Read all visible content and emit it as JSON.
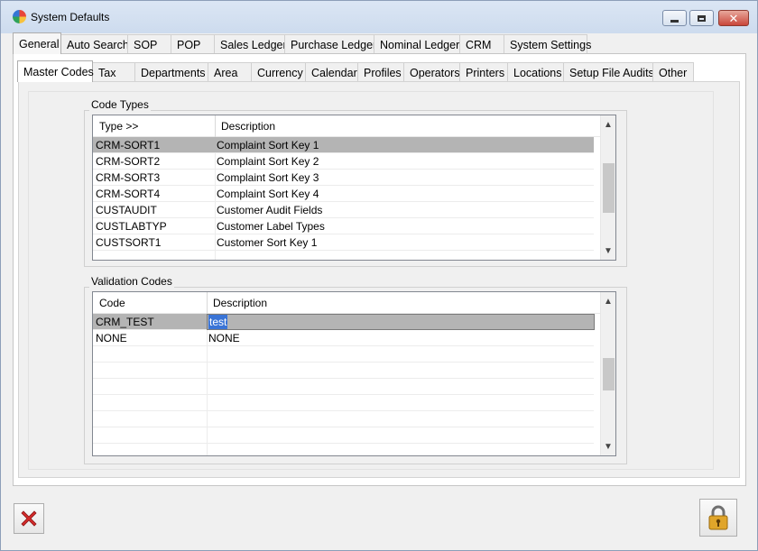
{
  "window": {
    "title": "System Defaults",
    "icon": "app-logo-icon",
    "controls": {
      "minimize": "minimize-icon",
      "maximize": "maximize-icon",
      "close": "close-icon"
    }
  },
  "main_tabs": [
    {
      "label": "General",
      "active": true
    },
    {
      "label": "Auto Search"
    },
    {
      "label": "SOP"
    },
    {
      "label": "POP"
    },
    {
      "label": "Sales Ledger"
    },
    {
      "label": "Purchase Ledger"
    },
    {
      "label": "Nominal Ledger"
    },
    {
      "label": "CRM"
    },
    {
      "label": "System Settings"
    }
  ],
  "sub_tabs": [
    {
      "label": "Master Codes",
      "active": true
    },
    {
      "label": "Tax"
    },
    {
      "label": "Departments"
    },
    {
      "label": "Area"
    },
    {
      "label": "Currency"
    },
    {
      "label": "Calendar"
    },
    {
      "label": "Profiles"
    },
    {
      "label": "Operators"
    },
    {
      "label": "Printers"
    },
    {
      "label": "Locations"
    },
    {
      "label": "Setup File Audits"
    },
    {
      "label": "Other"
    }
  ],
  "code_types": {
    "group_label": "Code Types",
    "columns": [
      "Type >>",
      "Description"
    ],
    "rows": [
      {
        "type": "CRM-SORT1",
        "description": "Complaint Sort Key 1",
        "selected": true
      },
      {
        "type": "CRM-SORT2",
        "description": "Complaint Sort Key 2"
      },
      {
        "type": "CRM-SORT3",
        "description": "Complaint Sort Key 3"
      },
      {
        "type": "CRM-SORT4",
        "description": "Complaint Sort Key 4"
      },
      {
        "type": "CUSTAUDIT",
        "description": "Customer Audit Fields"
      },
      {
        "type": "CUSTLABTYP",
        "description": "Customer Label Types"
      },
      {
        "type": "CUSTSORT1",
        "description": "Customer Sort Key 1"
      }
    ]
  },
  "validation_codes": {
    "group_label": "Validation Codes",
    "columns": [
      "Code",
      "Description"
    ],
    "rows": [
      {
        "code": "CRM_TEST",
        "description": "test",
        "selected": true,
        "editing": true
      },
      {
        "code": "NONE",
        "description": "NONE"
      }
    ]
  },
  "footer": {
    "cancel_icon": "red-x-icon",
    "lock_icon": "padlock-icon"
  },
  "colors": {
    "selected_row": "#b4b4b4",
    "edit_highlight": "#3a74d6",
    "cancel_red": "#d42a2a",
    "lock_gold": "#e0a52a"
  }
}
